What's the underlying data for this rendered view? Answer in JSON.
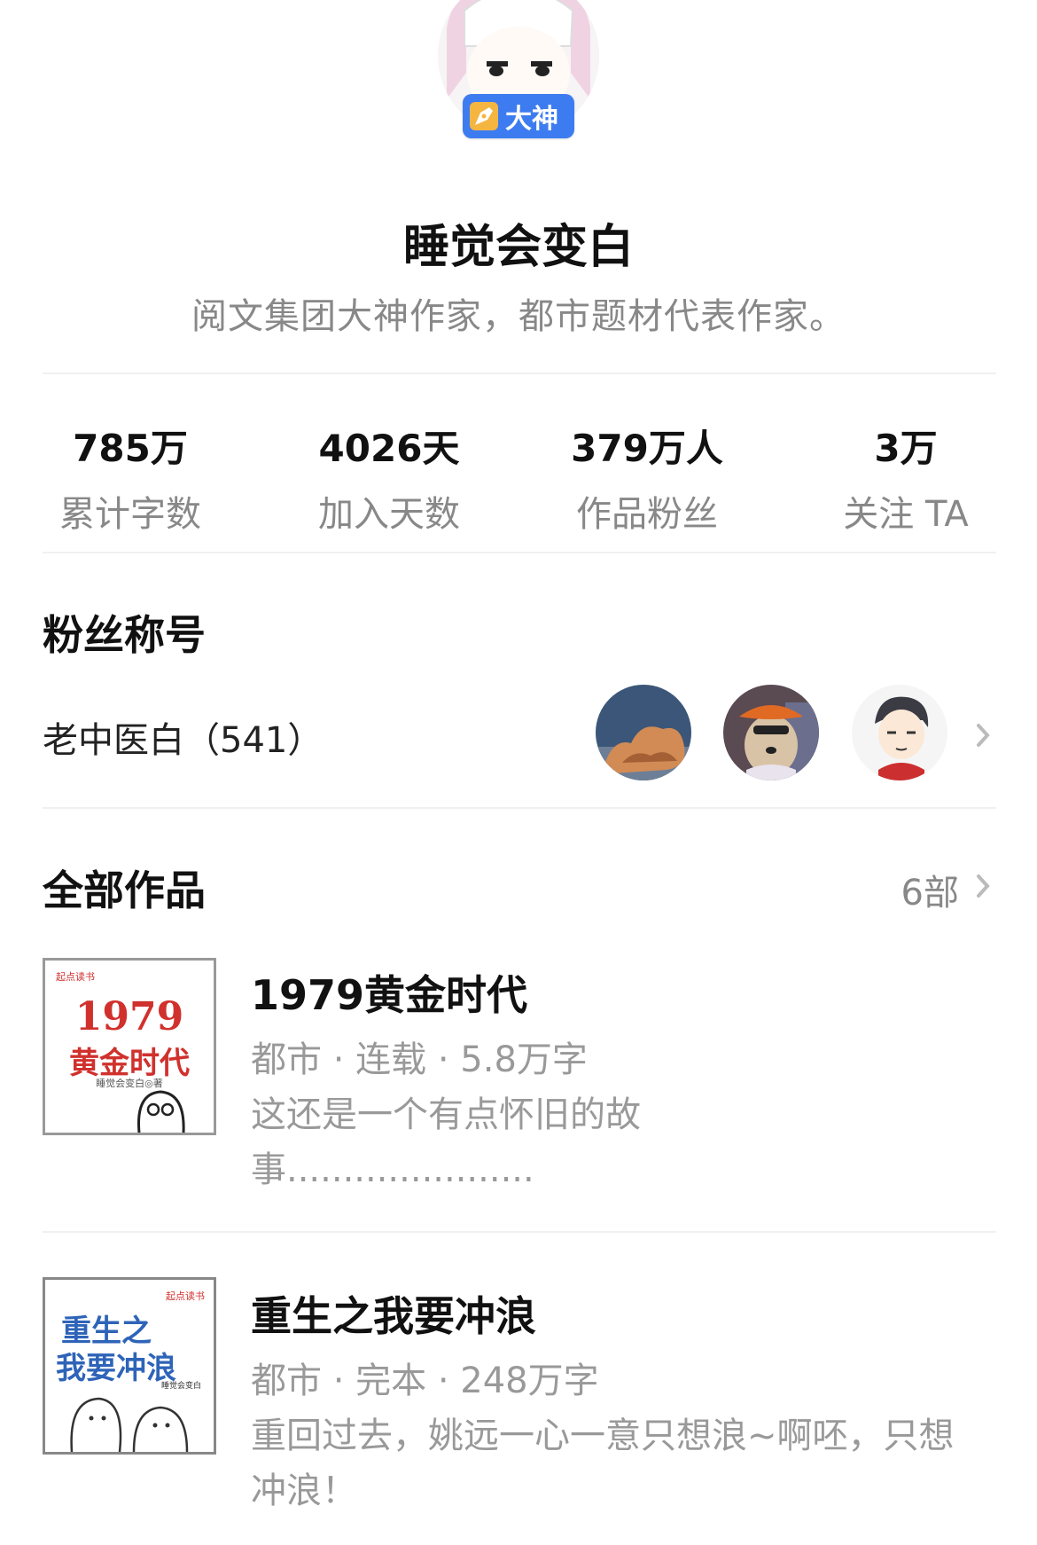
{
  "profile": {
    "badge_label": "大神",
    "name": "睡觉会变白",
    "bio": "阅文集团大神作家，都市题材代表作家。"
  },
  "stats": [
    {
      "value": "785万",
      "label": "累计字数"
    },
    {
      "value": "4026天",
      "label": "加入天数"
    },
    {
      "value": "379万人",
      "label": "作品粉丝"
    },
    {
      "value": "3万",
      "label": "关注 TA"
    }
  ],
  "fan_section": {
    "heading": "粉丝称号",
    "title": "老中医白（541）"
  },
  "works_section": {
    "heading": "全部作品",
    "count": "6部"
  },
  "books": [
    {
      "title": "1979黄金时代",
      "meta": "都市 · 连载 · 5.8万字",
      "desc_line1": "这还是一个有点怀旧的故",
      "desc_line2": "事......................",
      "cover": {
        "brand": "起点读书",
        "title_top": "1979",
        "title_bottom": "黄金时代",
        "author": "睡觉会变白◎著"
      }
    },
    {
      "title": "重生之我要冲浪",
      "meta": "都市 · 完本 · 248万字",
      "desc_line1": "重回过去，姚远一心一意只想浪~啊呸，只想",
      "desc_line2": "冲浪！",
      "cover": {
        "brand": "起点读书",
        "title_top": "重生之",
        "title_bottom": "我要冲浪",
        "author": "睡觉会变白"
      }
    }
  ],
  "colors": {
    "badge": "#3d7cf0",
    "accent_red": "#d0312d"
  }
}
